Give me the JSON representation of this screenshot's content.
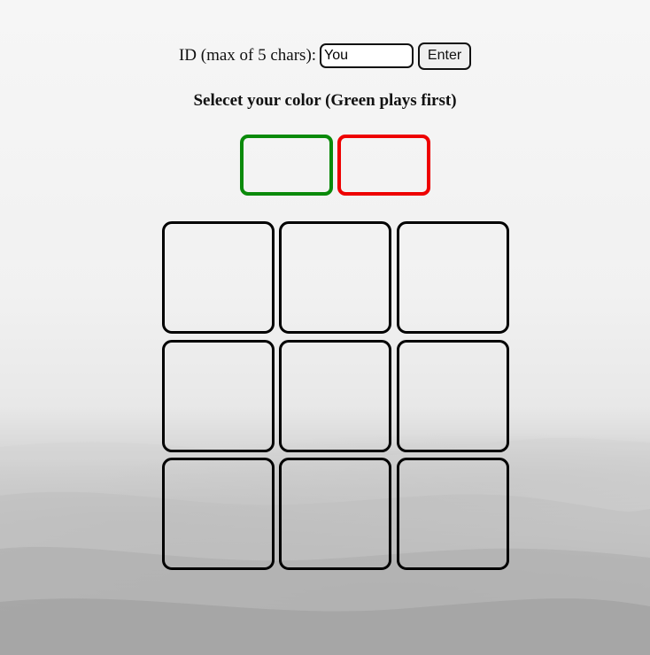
{
  "header": {
    "id_label": "ID (max of 5 chars):",
    "id_value": "You",
    "enter_label": "Enter"
  },
  "instruction": "Selecet your color (Green plays first)",
  "colors": {
    "green": "#0a8a0a",
    "red": "#ee0000"
  },
  "board": {
    "cells": [
      "",
      "",
      "",
      "",
      "",
      "",
      "",
      "",
      ""
    ]
  }
}
